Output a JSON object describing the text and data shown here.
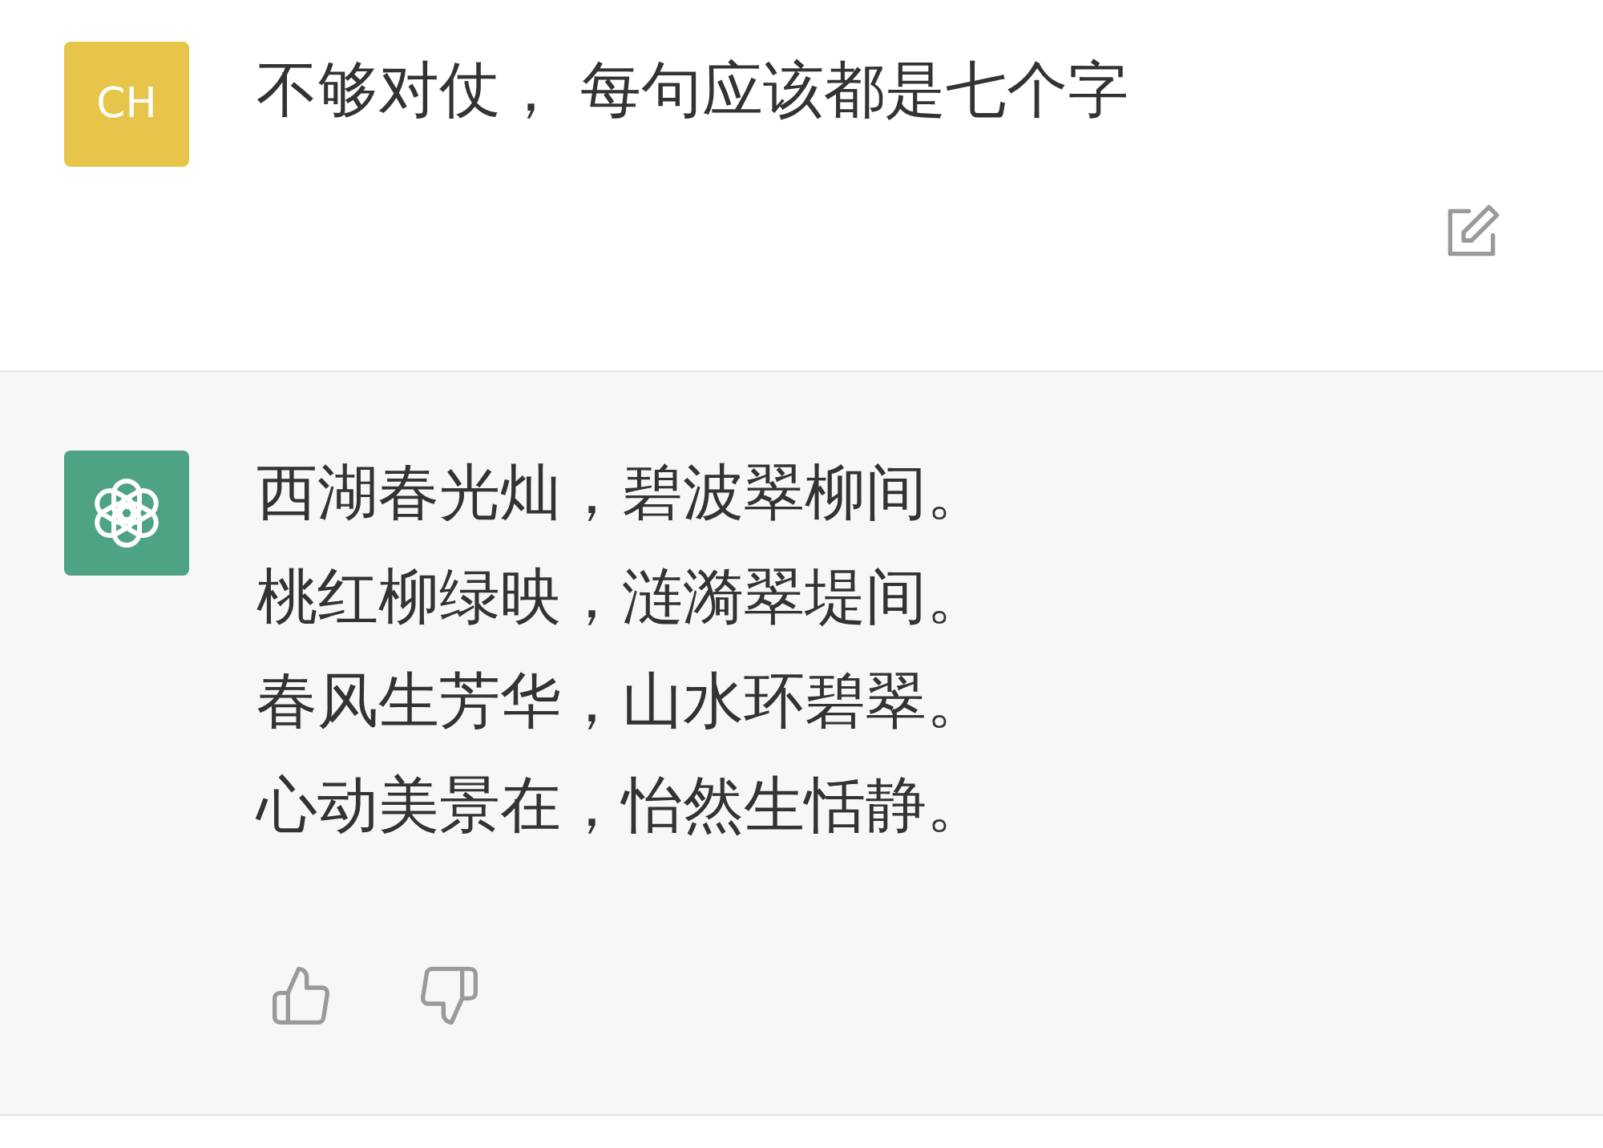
{
  "messages": [
    {
      "kind": "user",
      "avatar": {
        "initials": "CH"
      },
      "lines": [
        "不够对仗， 每句应该都是七个字"
      ],
      "editable": true
    },
    {
      "kind": "assistant",
      "lines": [
        "西湖春光灿，碧波翠柳间。",
        "桃红柳绿映，涟漪翠堤间。",
        "春风生芳华，山水环碧翠。",
        "心动美景在，怡然生恬静。"
      ],
      "feedback": true
    }
  ]
}
